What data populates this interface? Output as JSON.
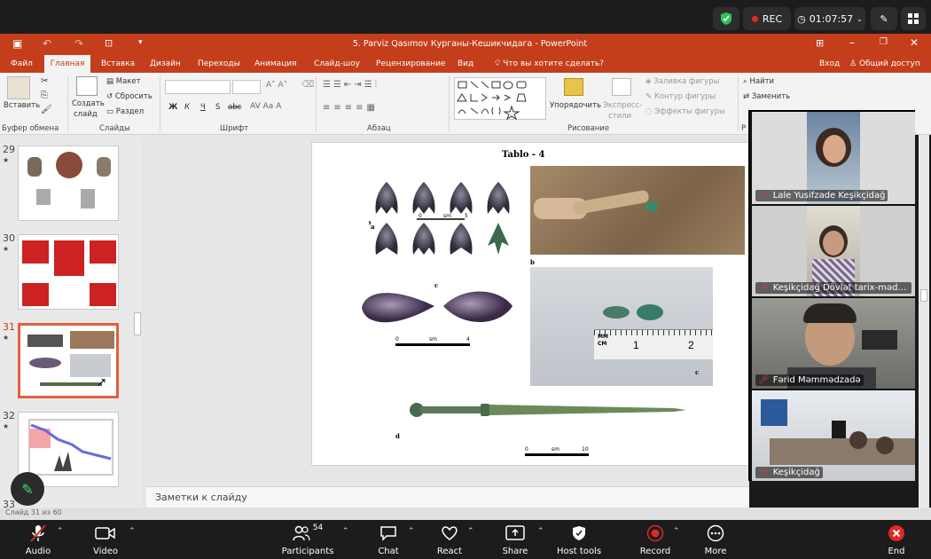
{
  "zoom_top": {
    "rec": "REC",
    "timer": "01:07:57"
  },
  "ppt": {
    "title": "5. Parviz Qasımov Курганы-Кешикчидага - PowerPoint",
    "login": "Вход",
    "share": "Общий доступ",
    "tabs": [
      "Файл",
      "Главная",
      "Вставка",
      "Дизайн",
      "Переходы",
      "Анимация",
      "Слайд-шоу",
      "Рецензирование",
      "Вид",
      "Что вы хотите сделать?"
    ],
    "ribbon": {
      "paste": "Вставить",
      "new_slide": [
        "Создать",
        "слайд"
      ],
      "layout": "Макет",
      "reset": "Сбросить",
      "section": "Раздел",
      "groups": [
        "Буфер обмена",
        "Слайды",
        "Шрифт",
        "Абзац",
        "Рисование",
        "Р"
      ],
      "font_btns": [
        "Ж",
        "К",
        "Ч",
        "S",
        "abc"
      ],
      "arrange": "Упорядочить",
      "quick_styles": [
        "Экспресс-",
        "стили"
      ],
      "fill": "Заливка фигуры",
      "outline": "Контур фигуры",
      "effects": "Эффекты фигуры",
      "find": "Найти",
      "replace": "Заменить"
    },
    "slide_numbers": [
      "29",
      "30",
      "31",
      "32",
      "33"
    ],
    "notes": "Заметки к слайду",
    "status": "Слайд 31 из 60"
  },
  "slide": {
    "title": "Tablo - 4",
    "labels": {
      "a": "a",
      "b": "b",
      "c": "c",
      "c2": "c",
      "d": "d"
    },
    "scale_text": "sm",
    "scale_nums": [
      "0",
      "5",
      "4",
      "10"
    ],
    "ruler_label": [
      "MM",
      "CM"
    ],
    "ruler_nums": [
      "1",
      "2"
    ]
  },
  "participants_video": [
    {
      "name": "Lale Yusifzade Keşikçidağ"
    },
    {
      "name": "Keşikçidağ Dövlət tarix-mədəniyyət qoruğu"
    },
    {
      "name": "Fərid Məmmədzadə"
    },
    {
      "name": "Keşikçidağ"
    }
  ],
  "zoom_bottom": {
    "audio": "Audio",
    "video": "Video",
    "participants": "Participants",
    "participants_count": "54",
    "chat": "Chat",
    "react": "React",
    "share": "Share",
    "host_tools": "Host tools",
    "record": "Record",
    "more": "More",
    "end": "End"
  },
  "colors": {
    "ppt_accent": "#c43e1c",
    "zoom_bg": "#1c1c1c",
    "rec_red": "#e02828",
    "shield_green": "#2ec45c"
  }
}
